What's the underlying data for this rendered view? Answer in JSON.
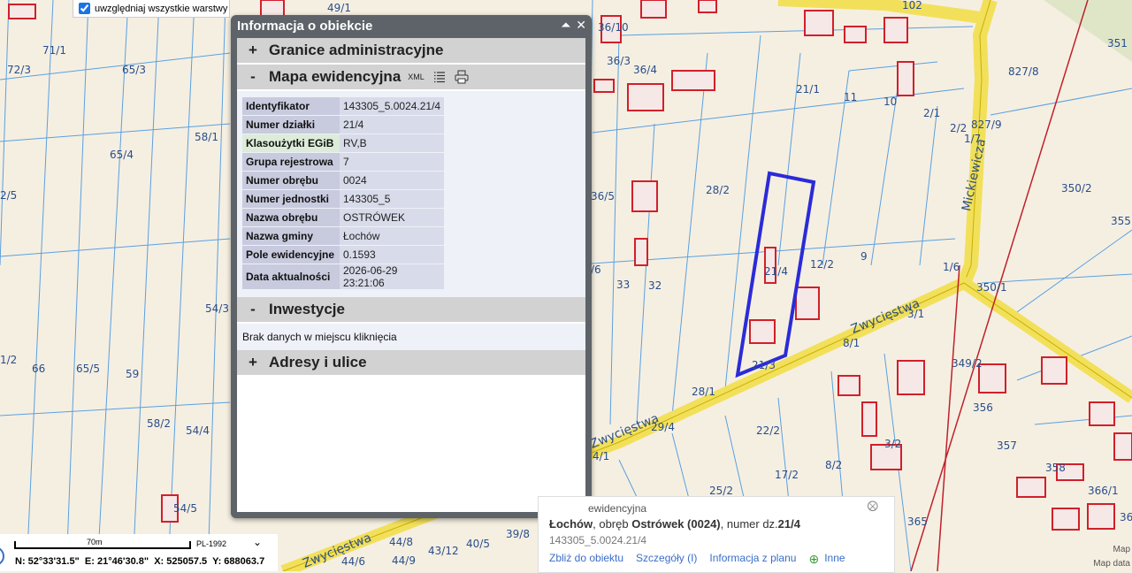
{
  "layer_toggle": {
    "label": "uwzględniaj wszystkie warstwy",
    "checked": true
  },
  "panel": {
    "title": "Informacja o obiekcie",
    "sections": [
      {
        "sign": "+",
        "label": "Granice administracyjne"
      },
      {
        "sign": "-",
        "label": "Mapa ewidencyjna",
        "tools": [
          "xml-icon",
          "list-icon",
          "print-icon"
        ],
        "xml_label": "XML"
      },
      {
        "sign": "-",
        "label": "Inwestycje"
      },
      {
        "sign": "+",
        "label": "Adresy i ulice"
      }
    ],
    "attributes": [
      {
        "key": "Identyfikator",
        "value": "143305_5.0024.21/4"
      },
      {
        "key": "Numer działki",
        "value": "21/4"
      },
      {
        "key": "Klasoużytki EGiB",
        "value": "RV,B"
      },
      {
        "key": "Grupa rejestrowa",
        "value": "7"
      },
      {
        "key": "Numer obrębu",
        "value": "0024"
      },
      {
        "key": "Numer jednostki",
        "value": "143305_5"
      },
      {
        "key": "Nazwa obrębu",
        "value": "OSTRÓWEK"
      },
      {
        "key": "Nazwa gminy",
        "value": "Łochów"
      },
      {
        "key": "Pole ewidencyjne",
        "value": "0.1593"
      },
      {
        "key": "Data aktualności",
        "value": "2026-06-29 23:21:06"
      }
    ],
    "inwestycje_text": "Brak danych w miejscu kliknięcia"
  },
  "scale": {
    "distance": "70m",
    "crs": "PL-1992",
    "n": "N: 52°33'31.5\"",
    "e": "E: 21°46'30.8\"",
    "x": "X: 525057.5",
    "y": "Y: 688063.7"
  },
  "popup": {
    "title": "ewidencyjna",
    "gmina": "Łochów",
    "obreb_prefix": ", obręb ",
    "obreb": "Ostrówek (0024)",
    "numer_prefix": ", numer dz.",
    "numer": "21/4",
    "id": "143305_5.0024.21/4",
    "links": [
      "Zbliż do obiektu",
      "Szczegóły (I)",
      "Informacja z planu",
      "Inne"
    ]
  },
  "map": {
    "parcel_labels": [
      "71/1",
      "72/3",
      "65/3",
      "58/1",
      "65/4",
      "2/5",
      "54/3",
      "1/2",
      "66",
      "65/5",
      "59",
      "58/2",
      "54/4",
      "54/5",
      "49/1",
      "36/10",
      "36/3",
      "36/4",
      "36/5",
      "/6",
      "33",
      "32",
      "28/2",
      "21/1",
      "11",
      "10",
      "2/1",
      "2/2",
      "1/7",
      "827/9",
      "827/8",
      "351",
      "350/2",
      "355",
      "21/4",
      "12/2",
      "9",
      "1/6",
      "350/1",
      "3/1",
      "8/1",
      "21/3",
      "28/1",
      "29/4",
      "22/2",
      "17/2",
      "8/2",
      "3/2",
      "349/2",
      "356",
      "357",
      "358",
      "366/1",
      "36",
      "365",
      "25/2",
      "39/8",
      "44/8",
      "44/9",
      "44/6",
      "43/12",
      "40/5",
      "4/1"
    ],
    "street_labels": [
      "Mickiewicza",
      "Zwycięstwa",
      "Zwycięstwa",
      "Zwycięstwa"
    ],
    "road_number": "102",
    "attribution_1": "Map",
    "attribution_2": "Map data"
  }
}
